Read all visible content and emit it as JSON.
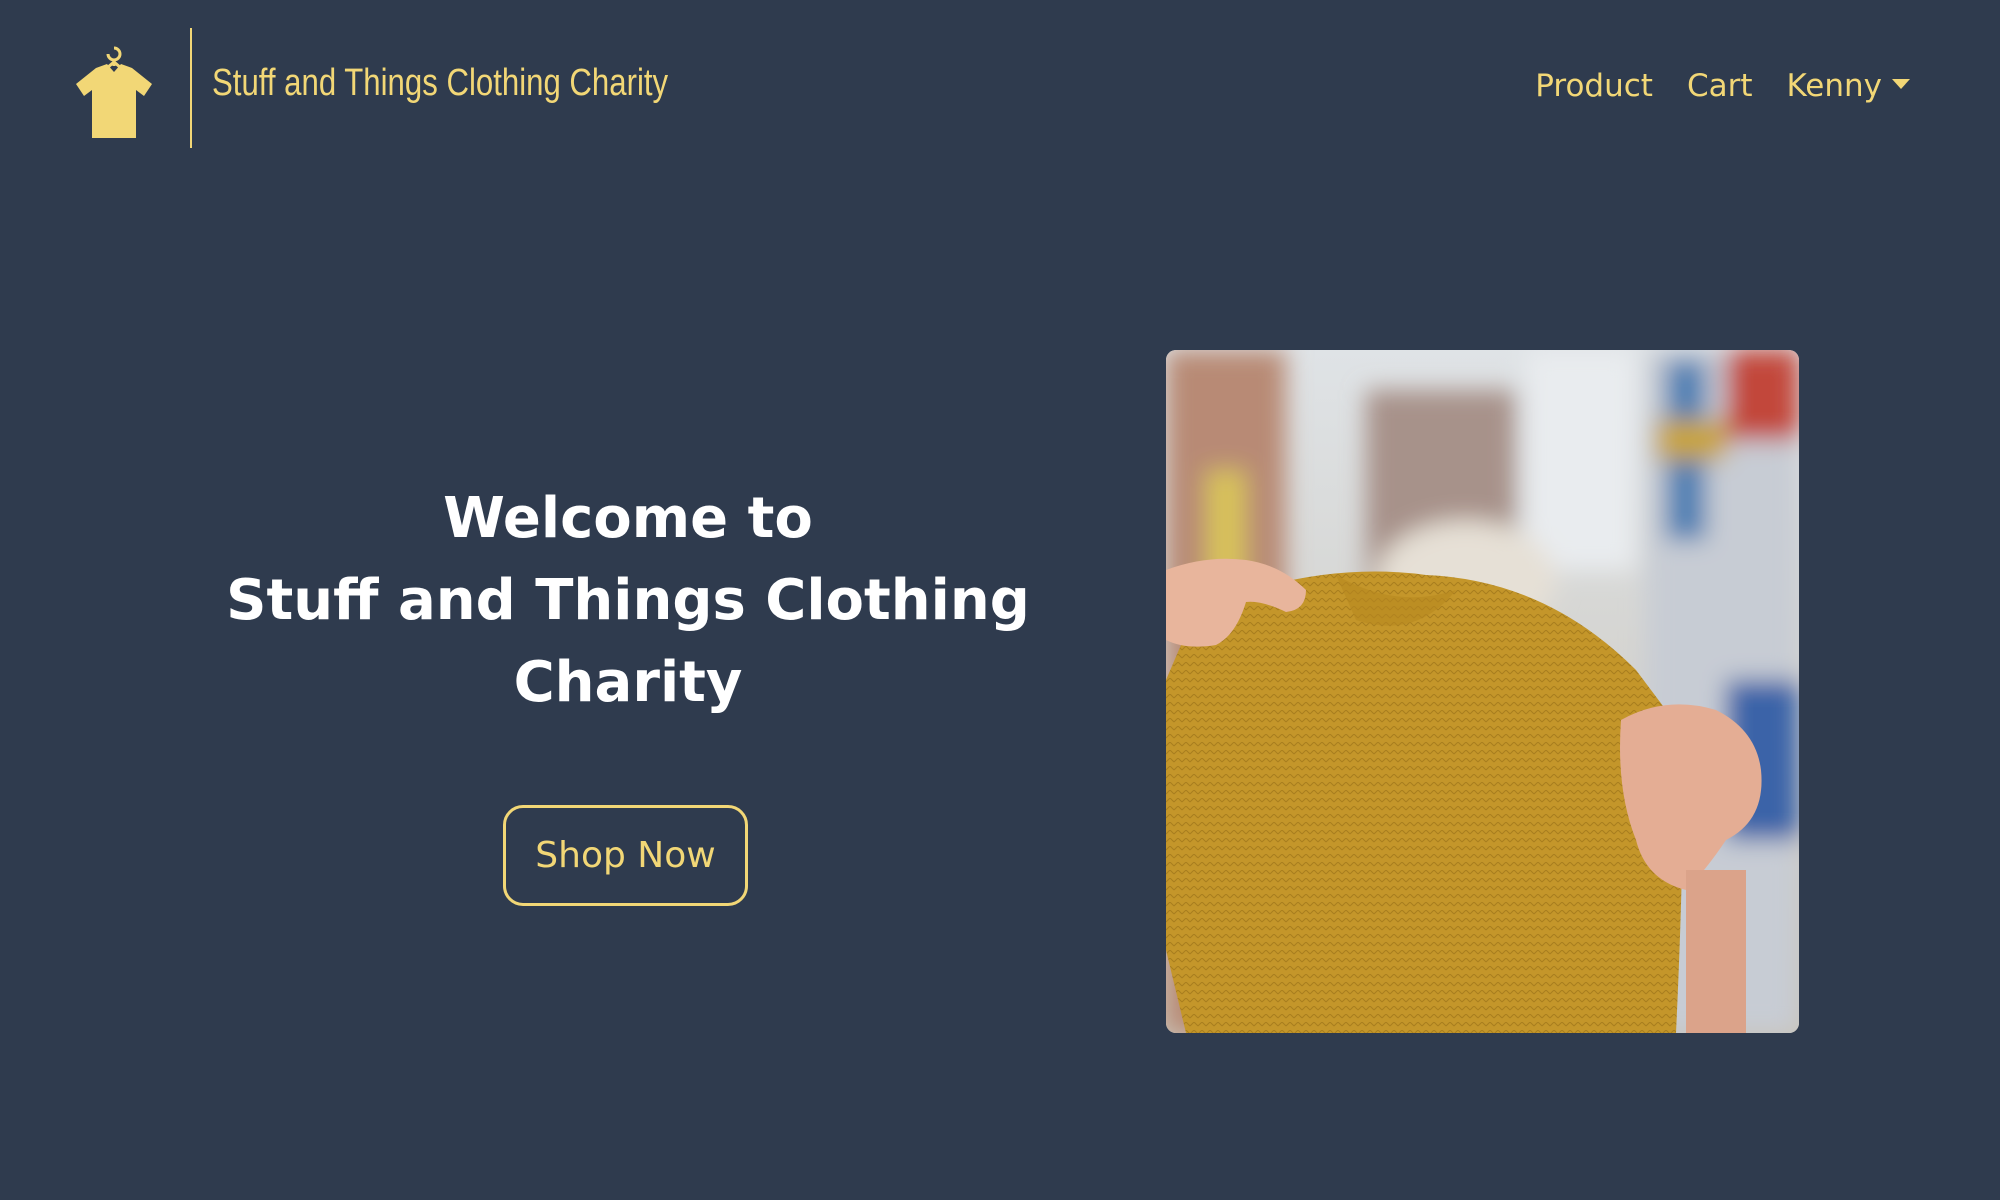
{
  "brand": {
    "name": "Stuff and Things Clothing Charity",
    "logo_icon": "tshirt-hanger-icon"
  },
  "nav": {
    "items": [
      {
        "label": "Product"
      },
      {
        "label": "Cart"
      }
    ],
    "user": {
      "label": "Kenny",
      "icon": "caret-down-icon"
    }
  },
  "hero": {
    "title_lines": [
      "Welcome to",
      "Stuff and Things Clothing",
      "Charity"
    ],
    "cta_label": "Shop Now"
  },
  "colors": {
    "background": "#2f3b4e",
    "accent": "#f2d776",
    "heading": "#ffffff",
    "sweater": "#c79a2c"
  }
}
